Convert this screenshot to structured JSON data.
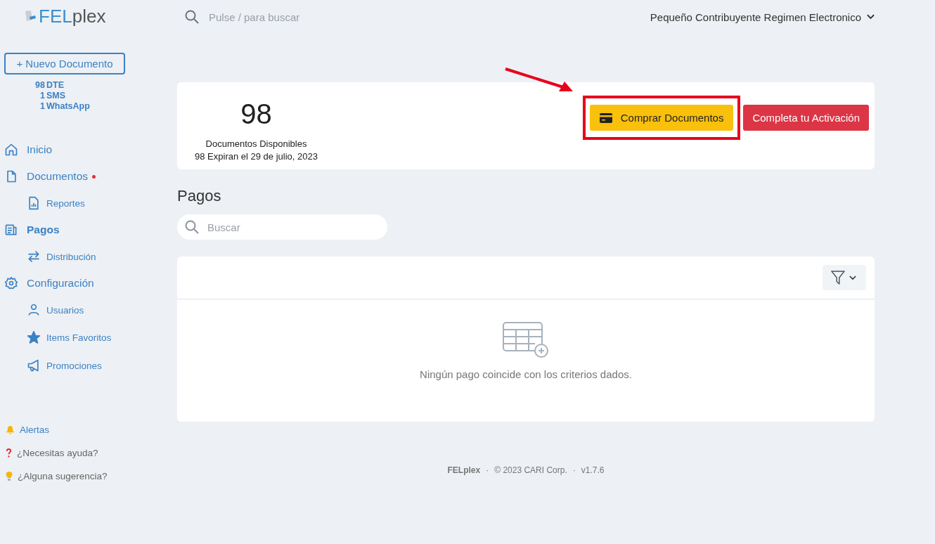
{
  "logo": {
    "part_1": "FEL",
    "part_2": "plex"
  },
  "header": {
    "search_placeholder": "Pulse / para buscar",
    "account": "Pequeño Contribuyente Regimen Electronico"
  },
  "sidebar": {
    "new_button": "+ Nuevo Documento",
    "credits": [
      {
        "count": "98",
        "label": "DTE"
      },
      {
        "count": "1",
        "label": "SMS"
      },
      {
        "count": "1",
        "label": "WhatsApp"
      }
    ],
    "items": [
      {
        "kind": "home",
        "label": "Inicio",
        "selected": false,
        "notify": false
      },
      {
        "kind": "document",
        "label": "Documentos",
        "selected": false,
        "notify": true,
        "children": [
          {
            "kind": "report",
            "label": "Reportes",
            "selected": false
          }
        ]
      },
      {
        "kind": "payments",
        "label": "Pagos",
        "selected": true,
        "notify": false,
        "children": [
          {
            "kind": "transfer",
            "label": "Distribución",
            "selected": false
          }
        ]
      },
      {
        "kind": "gear",
        "label": "Configuración",
        "selected": false,
        "notify": false,
        "children": [
          {
            "kind": "user",
            "label": "Usuarios",
            "selected": false
          },
          {
            "kind": "star",
            "label": "Items Favoritos",
            "selected": false
          },
          {
            "kind": "megaphone",
            "label": "Promociones",
            "selected": false
          }
        ]
      }
    ],
    "bottom_links": [
      {
        "kind": "bell",
        "label": "Alertas"
      },
      {
        "kind": "question",
        "label": "¿Necesitas ayuda?"
      },
      {
        "kind": "bulb",
        "label": "¿Alguna sugerencia?"
      }
    ]
  },
  "summary": {
    "count": "98",
    "caption": "Documentos Disponibles",
    "expiry": "98 Expiran el 29 de julio, 2023",
    "buy_button": {
      "label": "Comprar Documentos",
      "highlighted": true
    },
    "activation_button": "Completa tu Activación"
  },
  "page_title": "Pagos",
  "search": {
    "placeholder": "Buscar"
  },
  "table": {
    "empty_message": "Ningún pago coincide con los criterios dados."
  },
  "footer": {
    "brand": "FELplex",
    "separator": "·",
    "copyright": "© 2023 CARI Corp.",
    "version": "v1.7.6"
  }
}
